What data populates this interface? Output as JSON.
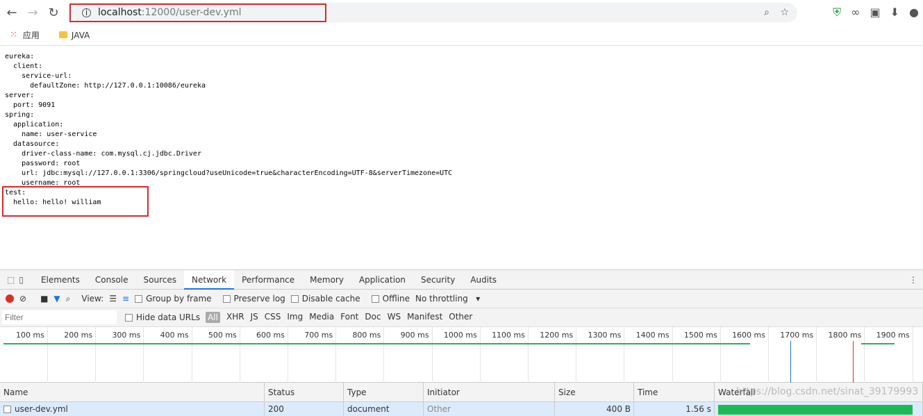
{
  "browser": {
    "url_host": "localhost",
    "url_path": ":12000/user-dev.yml",
    "bookmarks": [
      {
        "label": "应用",
        "icon": "apps-grid-icon"
      },
      {
        "label": "JAVA",
        "icon": "folder-icon"
      }
    ]
  },
  "content_lines": [
    "eureka:",
    "  client:",
    "    service-url:",
    "      defaultZone: http://127.0.0.1:10086/eureka",
    "server:",
    "  port: 9091",
    "spring:",
    "  application:",
    "    name: user-service",
    "  datasource:",
    "    driver-class-name: com.mysql.cj.jdbc.Driver",
    "    password: root",
    "    url: jdbc:mysql://127.0.0.1:3306/springcloud?useUnicode=true&characterEncoding=UTF-8&serverTimezone=UTC",
    "    username: root",
    "test:",
    "  hello: hello! william"
  ],
  "devtools": {
    "tabs": [
      "Elements",
      "Console",
      "Sources",
      "Network",
      "Performance",
      "Memory",
      "Application",
      "Security",
      "Audits"
    ],
    "active_tab": "Network",
    "toolbar": {
      "view_label": "View:",
      "group_by_frame": "Group by frame",
      "preserve_log": "Preserve log",
      "disable_cache": "Disable cache",
      "offline": "Offline",
      "throttling": "No throttling"
    },
    "filter": {
      "placeholder": "Filter",
      "hide_data_urls": "Hide data URLs",
      "types": [
        "All",
        "XHR",
        "JS",
        "CSS",
        "Img",
        "Media",
        "Font",
        "Doc",
        "WS",
        "Manifest",
        "Other"
      ]
    },
    "timeline_ticks": [
      "100 ms",
      "200 ms",
      "300 ms",
      "400 ms",
      "500 ms",
      "600 ms",
      "700 ms",
      "800 ms",
      "900 ms",
      "1000 ms",
      "1100 ms",
      "1200 ms",
      "1300 ms",
      "1400 ms",
      "1500 ms",
      "1600 ms",
      "1700 ms",
      "1800 ms",
      "1900 ms"
    ],
    "columns": [
      "Name",
      "Status",
      "Type",
      "Initiator",
      "Size",
      "Time",
      "Waterfall"
    ],
    "rows": [
      {
        "name": "user-dev.yml",
        "status": "200",
        "type": "document",
        "initiator": "Other",
        "size": "400 B",
        "time": "1.56 s"
      }
    ],
    "colors": {
      "active_tab": "#1a73e8",
      "waterfall": "#1db954",
      "dom_line": "#1a73e8",
      "load_line": "#d93025"
    }
  },
  "watermark": "https://blog.csdn.net/sinat_39179993"
}
